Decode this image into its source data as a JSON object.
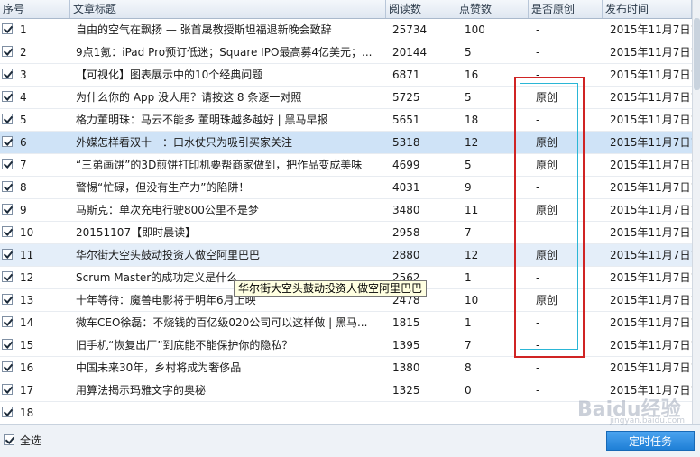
{
  "columns": {
    "no": "序号",
    "title": "文章标题",
    "reads": "阅读数",
    "likes": "点赞数",
    "original": "是否原创",
    "time": "发布时间"
  },
  "rows": [
    {
      "no": "1",
      "title": "自由的空气在飘扬 — 张首晟教授斯坦福退新晚会致辞",
      "reads": "25734",
      "likes": "100",
      "original": "-",
      "time": "2015年11月7日1"
    },
    {
      "no": "2",
      "title": "9点1氪：iPad Pro预订低迷；Square IPO最高募4亿美元；...",
      "reads": "20144",
      "likes": "5",
      "original": "-",
      "time": "2015年11月7日1"
    },
    {
      "no": "3",
      "title": "【可视化】图表展示中的10个经典问题",
      "reads": "6871",
      "likes": "16",
      "original": "-",
      "time": "2015年11月7日1"
    },
    {
      "no": "4",
      "title": "为什么你的 App 没人用？请按这 8 条逐一对照",
      "reads": "5725",
      "likes": "5",
      "original": "原创",
      "time": "2015年11月7日1"
    },
    {
      "no": "5",
      "title": "格力董明珠：马云不能多 董明珠越多越好 | 黑马早报",
      "reads": "5651",
      "likes": "18",
      "original": "-",
      "time": "2015年11月7日1"
    },
    {
      "no": "6",
      "title": "外媒怎样看双十一：口水仗只为吸引买家关注",
      "reads": "5318",
      "likes": "12",
      "original": "原创",
      "time": "2015年11月7日1"
    },
    {
      "no": "7",
      "title": "“三弟画饼”的3D煎饼打印机要帮商家做到，把作品变成美味",
      "reads": "4699",
      "likes": "5",
      "original": "原创",
      "time": "2015年11月7日1"
    },
    {
      "no": "8",
      "title": "警惕“忙碌，但没有生产力”的陷阱！",
      "reads": "4031",
      "likes": "9",
      "original": "-",
      "time": "2015年11月7日1"
    },
    {
      "no": "9",
      "title": "马斯克：单次充电行驶800公里不是梦",
      "reads": "3480",
      "likes": "11",
      "original": "原创",
      "time": "2015年11月7日1"
    },
    {
      "no": "10",
      "title": "20151107【即时晨读】",
      "reads": "2958",
      "likes": "7",
      "original": "-",
      "time": "2015年11月7日1"
    },
    {
      "no": "11",
      "title": "华尔街大空头鼓动投资人做空阿里巴巴",
      "reads": "2880",
      "likes": "12",
      "original": "原创",
      "time": "2015年11月7日1"
    },
    {
      "no": "12",
      "title": "Scrum Master的成功定义是什么",
      "reads": "2562",
      "likes": "1",
      "original": "-",
      "time": "2015年11月7日1"
    },
    {
      "no": "13",
      "title": "十年等待：魔兽电影将于明年6月上映",
      "reads": "2478",
      "likes": "10",
      "original": "原创",
      "time": "2015年11月7日1"
    },
    {
      "no": "14",
      "title": "微车CEO徐磊：不烧钱的百亿级020公司可以这样做 | 黑马...",
      "reads": "1815",
      "likes": "1",
      "original": "-",
      "time": "2015年11月7日1"
    },
    {
      "no": "15",
      "title": "旧手机“恢复出厂”到底能不能保护你的隐私？",
      "reads": "1395",
      "likes": "7",
      "original": "-",
      "time": "2015年11月7日1"
    },
    {
      "no": "16",
      "title": "中国未来30年，乡村将成为奢侈品",
      "reads": "1380",
      "likes": "8",
      "original": "-",
      "time": "2015年11月7日1"
    },
    {
      "no": "17",
      "title": "用算法揭示玛雅文字的奥秘",
      "reads": "1325",
      "likes": "0",
      "original": "-",
      "time": "2015年11月7日1"
    },
    {
      "no": "18",
      "title": "",
      "reads": "",
      "likes": "",
      "original": "",
      "time": ""
    }
  ],
  "tooltip": "华尔街大空头鼓动投资人做空阿里巴巴",
  "footer": {
    "select_all": "全选",
    "schedule_button": "定时任务"
  },
  "watermark": {
    "logo": "Baidu经验",
    "url": "jingyan.baidu.com"
  },
  "colors": {
    "selected_row": "#cfe3f7",
    "highlight_box": "#d02424",
    "inner_box": "#2ab6d6",
    "button": "#1f7fd6"
  }
}
